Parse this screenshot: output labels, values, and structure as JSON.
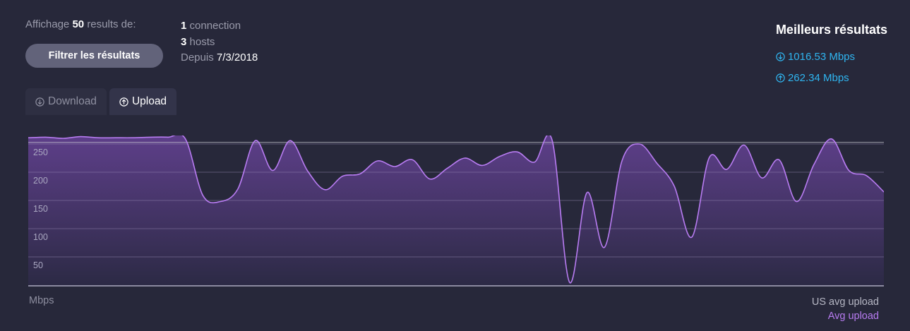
{
  "summary": {
    "prefix": "Affichage",
    "count": "50",
    "suffix": "results de:"
  },
  "filter_button": "Filtrer les résultats",
  "meta": {
    "connections_count": "1",
    "connections_label": "connection",
    "hosts_count": "3",
    "hosts_label": "hosts",
    "since_label": "Depuis",
    "since_date": "7/3/2018"
  },
  "best": {
    "title": "Meilleurs résultats",
    "download": "1016.53 Mbps",
    "upload": "262.34 Mbps",
    "download_icon": "arrow-down-circle-icon",
    "upload_icon": "arrow-up-circle-icon"
  },
  "tabs": [
    {
      "label": "Download",
      "icon": "arrow-down-circle-icon",
      "active": false
    },
    {
      "label": "Upload",
      "icon": "arrow-up-circle-icon",
      "active": true
    }
  ],
  "chart_data": {
    "type": "area",
    "y_unit_label": "Mbps",
    "y_ticks": [
      50,
      100,
      150,
      200,
      250
    ],
    "ylim": [
      0,
      300
    ],
    "grid": true,
    "series": [
      {
        "name": "US avg upload",
        "values": [
          253,
          253,
          253,
          253,
          253,
          253,
          253,
          253,
          253,
          253,
          253,
          253,
          253,
          253,
          253,
          253,
          253,
          253,
          253,
          253,
          253,
          253,
          253,
          253,
          253,
          253,
          253,
          253,
          253,
          253,
          253,
          253,
          253,
          253,
          253,
          253,
          253,
          253,
          253,
          253,
          253,
          253,
          253,
          253,
          253,
          253,
          253,
          253,
          253,
          253
        ]
      },
      {
        "name": "Avg upload",
        "values": [
          261,
          262,
          260,
          263,
          261,
          261,
          261,
          262,
          262,
          259,
          159,
          148,
          170,
          256,
          203,
          256,
          202,
          169,
          193,
          197,
          220,
          210,
          222,
          188,
          207,
          225,
          212,
          228,
          236,
          218,
          257,
          5,
          164,
          67,
          220,
          250,
          216,
          175,
          85,
          226,
          205,
          248,
          190,
          222,
          148,
          214,
          259,
          203,
          194,
          165
        ]
      }
    ]
  },
  "footer": {
    "left": "Mbps",
    "right_line1": "US avg upload",
    "right_line2": "Avg upload"
  },
  "colors": {
    "background": "#27283a",
    "accent_blue": "#2fb5f0",
    "line_purple": "#b87cf2",
    "fill_purple": "#5e3f8a"
  }
}
